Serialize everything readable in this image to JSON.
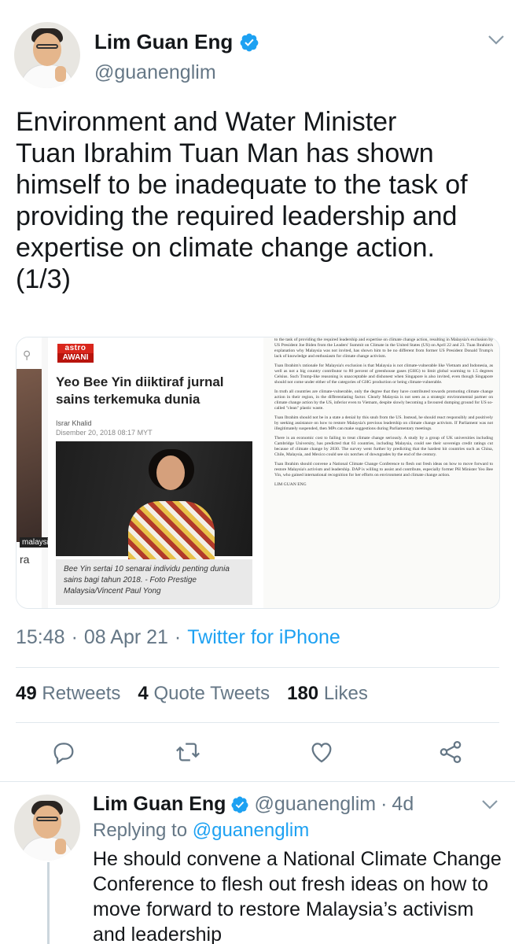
{
  "tweet": {
    "display_name": "Lim Guan Eng",
    "handle": "@guanenglim",
    "text": "Environment and Water Minister\nTuan Ibrahim Tuan Man has shown\nhimself to be inadequate to the task of\nproviding the required leadership and\nexpertise on climate change action.\n(1/3)",
    "time": "15:48",
    "date": "08 Apr 21",
    "separator": "·",
    "source": "Twitter for iPhone",
    "stats": {
      "retweets_count": "49",
      "retweets_label": "Retweets",
      "quotes_count": "4",
      "quotes_label": "Quote Tweets",
      "likes_count": "180",
      "likes_label": "Likes"
    },
    "icons": {
      "verified": "verified-badge-icon",
      "menu": "chevron-down-icon",
      "reply": "reply-icon",
      "retweet": "retweet-icon",
      "like": "heart-icon",
      "share": "share-icon"
    },
    "colors": {
      "accent": "#1da1f2",
      "secondary_text": "#657786",
      "primary_text": "#14171a"
    }
  },
  "media": {
    "article": {
      "logo_top": "astro",
      "logo_bottom": "AWANI",
      "title": "Yeo Bee Yin diiktiraf jurnal sains terkemuka dunia",
      "author": "Israr Khalid",
      "date": "Disember 20, 2018 08:17 MYT",
      "caption": "Bee Yin sertai 10 senarai individu penting dunia sains bagi tahun 2018. - Foto Prestige Malaysia/Vincent Paul Yong"
    },
    "side_strip": {
      "source_tag": "malaysiakini.com",
      "fragment": "ra"
    },
    "document": {
      "paragraphs": [
        "to the task of providing the required leadership and expertise on climate change action, resulting in Malaysia's exclusion by US President Joe Biden from the Leaders' Summit on Climate in the United States (US) on April 22 and 23. Tuan Ibrahim's explanation why Malaysia was not invited, has shown him to be no different from former US President Donald Trump's lack of knowledge and enthusiasm for climate change activism.",
        "Tuan Ibrahim's rationale for Malaysia's exclusion is that Malaysia is not climate-vulnerable like Vietnam and Indonesia, as well as not a big country contributor to 80 percent of greenhouse gases (GHG) to limit global warming to 1.5 degrees Celsius. Such Trump-like reasoning is unacceptable and dishonest when Singapore is also invited, even though Singapore should not come under either of the categories of GHG production or being climate-vulnerable.",
        "In truth all countries are climate-vulnerable, only the degree that they have contributed towards promoting climate change action in their region, in the differentiating factor. Clearly Malaysia is not seen as a strategic environmental partner on climate change action by the US, inferior even to Vietnam, despite slowly becoming a favoured dumping ground for US so-called \"clean\" plastic waste.",
        "Tuan Ibrahim should not be in a state a denial by this snub from the US. Instead, he should react responsibly and positively by seeking assistance on how to restore Malaysia's previous leadership on climate change activism. If Parliament was not illegitimately suspended, then MPs can make suggestions during Parliamentary meetings.",
        "There is an economic cost to failing to treat climate change seriously. A study by a group of UK universities including Cambridge University, has predicted that 63 countries, including Malaysia, could see their sovereign credit ratings cut because of climate change by 2030. The survey went further by predicting that the hardest hit countries such as China, Chile, Malaysia, and Mexico could see six notches of downgrades by the end of the century.",
        "Tuan Ibrahim should convene a National Climate Change Conference to flesh out fresh ideas on how to move forward to restore Malaysia's activism and leadership. DAP is willing to assist and contribute, especially former PH Minister Yeo Bee Yin, who gained international recognition for her efforts on environment and climate change action."
      ],
      "signature": "LIM GUAN ENG"
    }
  },
  "reply": {
    "display_name": "Lim Guan Eng",
    "handle": "@guanenglim",
    "separator": "·",
    "age": "4d",
    "replying_prefix": "Replying to",
    "replying_handle": "@guanenglim",
    "text": "He should convene a National Climate Change Conference to flesh out fresh ideas on how to move forward to restore Malaysia’s activism and leadership"
  }
}
